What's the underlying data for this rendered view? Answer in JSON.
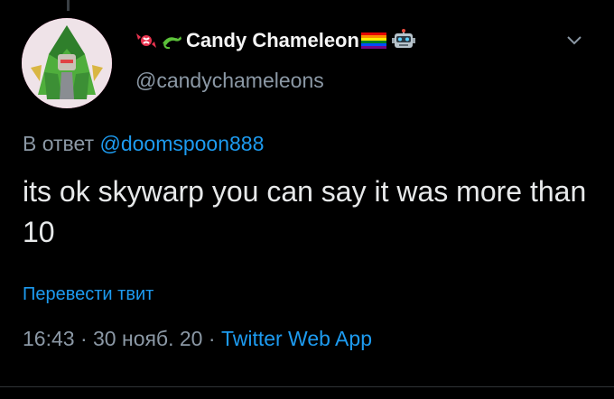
{
  "tweet": {
    "author": {
      "display_name": "Candy Chameleon",
      "handle": "@candychameleons",
      "avatar_icon": "robot-character-avatar",
      "prefix_emojis": [
        "candy-emoji",
        "lizard-emoji"
      ],
      "suffix_emojis": [
        "rainbow-flag-emoji",
        "robot-emoji"
      ]
    },
    "reply_label": "В ответ",
    "reply_mention": "@doomspoon888",
    "text": "its ok skywarp you can say it was more than 10",
    "translate_label": "Перевести твит",
    "time": "16:43",
    "separator1": " · ",
    "date": "30 нояб. 20",
    "separator2": " · ",
    "source": "Twitter Web App"
  },
  "colors": {
    "background": "#000000",
    "link": "#1d9bf0",
    "secondary_text": "#8b98a5",
    "primary_text": "#e7e9ea"
  }
}
